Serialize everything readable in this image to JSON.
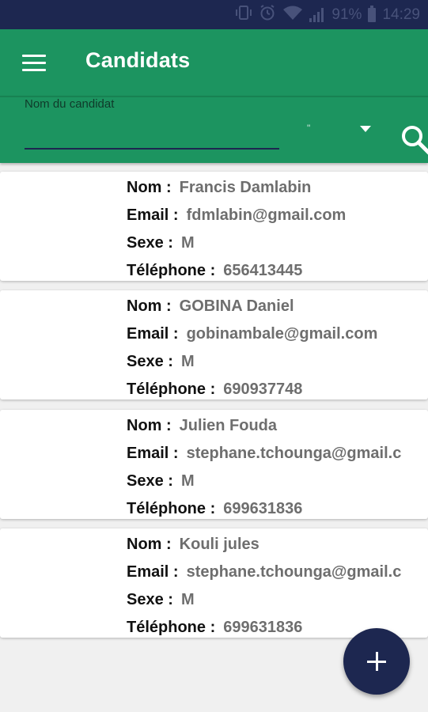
{
  "status_bar": {
    "battery": "91%",
    "time": "14:29",
    "icons": [
      "vibrate-icon",
      "alarm-icon",
      "wifi-icon",
      "signal-icon",
      "battery-icon"
    ]
  },
  "app_bar": {
    "title": "Candidats",
    "menu_icon": "hamburger-menu-icon"
  },
  "search": {
    "label": "Nom du candidat",
    "value": "",
    "selected_option": "\"",
    "search_icon": "magnifier-icon"
  },
  "labels": {
    "name": "Nom :",
    "email": "Email :",
    "sex": "Sexe :",
    "phone": "Téléphone :"
  },
  "candidates": [
    {
      "name": "Francis Damlabin",
      "email": "fdmlabin@gmail.com",
      "sex": "M",
      "phone": "656413445"
    },
    {
      "name": "GOBINA Daniel",
      "email": "gobinambale@gmail.com",
      "sex": "M",
      "phone": "690937748"
    },
    {
      "name": "Julien Fouda",
      "email": "stephane.tchounga@gmail.c",
      "sex": "M",
      "phone": "699631836"
    },
    {
      "name": "Kouli jules",
      "email": "stephane.tchounga@gmail.c",
      "sex": "M",
      "phone": "699631836"
    }
  ],
  "fab": {
    "icon": "plus-icon"
  },
  "colors": {
    "primary": "#1c9460",
    "status_bar": "#1d2750",
    "fab": "#1d2750"
  }
}
